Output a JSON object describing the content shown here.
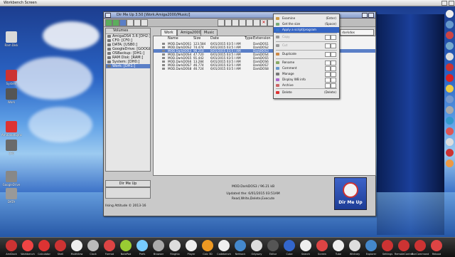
{
  "screen": {
    "title": "Workbench Screen"
  },
  "window": {
    "title": "Dir Me Up 3.50 [Work:Amiga2000/Music/]",
    "volumes_header": "Volumes",
    "volumes": [
      {
        "label": "AmigaOS4 3.6 [DH2:]"
      },
      {
        "label": "CF0: [CF0:]"
      },
      {
        "label": "DATA: [USB0:]"
      },
      {
        "label": "GoogleDrive: [GOOGLE"
      },
      {
        "label": "OSBackup: [DH1:]"
      },
      {
        "label": "RAM Disk: [RAM:]"
      },
      {
        "label": "System: [DH0:]"
      },
      {
        "label": "Work: [DH1:]",
        "selected": true
      }
    ],
    "tabs": [
      "Work",
      "Amiga2000",
      "Music"
    ],
    "columns": {
      "name": "Name",
      "size": "Size",
      "date": "Date",
      "type": "Type",
      "extension": "Extension",
      "d": "D"
    },
    "files": [
      {
        "name": "MOD.DarkDOS1",
        "size": "123.584",
        "date": "6/01/2015 03:5 I AM",
        "ext": "DarkDOS1"
      },
      {
        "name": "MOD.DarkDOS2",
        "size": "74.474",
        "date": "6/01/2015 03:5 I AM",
        "ext": "DarkDOS2"
      },
      {
        "name": "MOD.DarkDOS3",
        "size": "96.210",
        "date": "6/01/2015 03:5 I AM",
        "ext": "DarkDOS3",
        "selected": true
      },
      {
        "name": "MOD.DarkDOS4",
        "size": "47.720",
        "date": "6/01/2015 03:5 I AM",
        "ext": "DarkDOS4"
      },
      {
        "name": "MOD.DarkDOS5",
        "size": "91.442",
        "date": "6/01/2015 03:5 I AM",
        "ext": "DarkDOS5"
      },
      {
        "name": "MOD.DarkDOS6",
        "size": "13.284",
        "date": "6/01/2015 03:5 I AM",
        "ext": "DarkDOS6"
      },
      {
        "name": "MOD.DarkDOS7",
        "size": "46.774",
        "date": "6/01/2015 03:5 I AM",
        "ext": "DarkDOS7"
      },
      {
        "name": "MOD.DarkDOS8",
        "size": "46.724",
        "date": "6/01/2015 03:5 I AM",
        "ext": "DarkDOS8"
      }
    ],
    "bottom_button": "Dir Me Up",
    "byline": "Ilsing Attitude © 2013-16",
    "info_name": "MOD.DarkDOS3 / 96.21 kB",
    "info_updated": "Updated the:   6/01/2015 03:51AM",
    "info_protection": "Read,Write,Delete,Execute",
    "logo_text": "Dir Me Up",
    "path_field": "darkdos"
  },
  "menu": {
    "items": [
      {
        "label": "Examine",
        "key": "(Enter)"
      },
      {
        "label": "Get the size",
        "key": "(Space)"
      },
      {
        "label": "Apply a script/program",
        "key": "",
        "selected": true
      },
      {
        "label": "Copy",
        "key": "",
        "disabled": true
      },
      {
        "label": "Cut",
        "key": "",
        "disabled": true
      },
      {
        "label": "Duplicate",
        "key": ""
      },
      {
        "label": "Rename",
        "key": ""
      },
      {
        "label": "Comment",
        "key": ""
      },
      {
        "label": "Manage",
        "key": ""
      },
      {
        "label": "Display WB info",
        "key": ""
      },
      {
        "label": "Archive",
        "key": ""
      },
      {
        "label": "Delete",
        "key": "(Delete)"
      }
    ]
  },
  "desktop_icons": [
    {
      "label": "Ram Disk"
    },
    {
      "label": "System"
    },
    {
      "label": "Work"
    },
    {
      "label": "AmiCloudSync"
    },
    {
      "label": "CF0"
    },
    {
      "label": "GoogleDrive"
    },
    {
      "label": "DATA"
    }
  ],
  "dock": [
    {
      "label": "AmiDock"
    },
    {
      "label": "Workbench"
    },
    {
      "label": "Calculator"
    },
    {
      "label": "Shell"
    },
    {
      "label": "MultiView"
    },
    {
      "label": "Clock"
    },
    {
      "label": "Format"
    },
    {
      "label": "NotePad"
    },
    {
      "label": "Prefs"
    },
    {
      "label": "Browser"
    },
    {
      "label": "Ringhio"
    },
    {
      "label": "Player"
    },
    {
      "label": "Calc 3D"
    },
    {
      "label": "Codebench"
    },
    {
      "label": "Nethack"
    },
    {
      "label": "Odyssey"
    },
    {
      "label": "Editor"
    },
    {
      "label": "Cube"
    },
    {
      "label": "Search"
    },
    {
      "label": "Screen"
    },
    {
      "label": "Tube"
    },
    {
      "label": "Whitney"
    },
    {
      "label": "Explorer"
    },
    {
      "label": "Settings"
    },
    {
      "label": "RemoteControl"
    },
    {
      "label": "RunCommand"
    },
    {
      "label": "Reboot"
    }
  ]
}
